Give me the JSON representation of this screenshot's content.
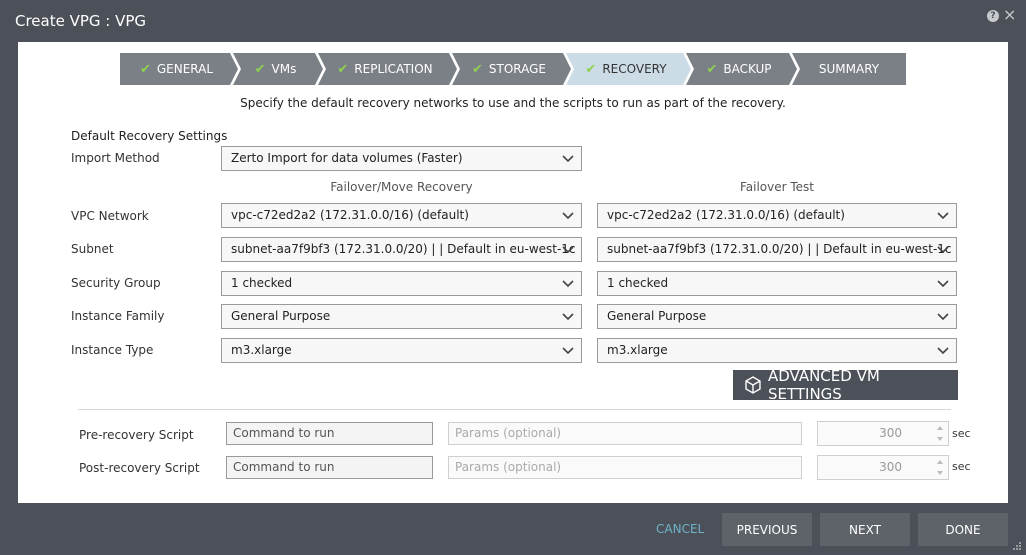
{
  "window": {
    "title": "Create VPG : VPG",
    "help_glyph": "?",
    "close_glyph": "×"
  },
  "wizard": {
    "steps": [
      {
        "label": "GENERAL",
        "done": true
      },
      {
        "label": "VMs",
        "done": true
      },
      {
        "label": "REPLICATION",
        "done": true
      },
      {
        "label": "STORAGE",
        "done": true
      },
      {
        "label": "RECOVERY",
        "done": true,
        "active": true
      },
      {
        "label": "BACKUP",
        "done": true
      },
      {
        "label": "SUMMARY",
        "done": false
      }
    ],
    "check_glyph": "✔",
    "colors": {
      "step": "#7b7f86",
      "active": "#ccdce6",
      "active_text": "#333333",
      "check": "#8fd14f"
    }
  },
  "subtitle": "Specify the default recovery networks to use and the scripts to run as part of the recovery.",
  "recovery": {
    "section_title": "Default Recovery Settings",
    "import_method": {
      "label": "Import Method",
      "value": "Zerto Import for data volumes (Faster)"
    },
    "columns": {
      "failover": "Failover/Move Recovery",
      "test": "Failover Test"
    },
    "rows": [
      {
        "label": "VPC Network",
        "failover": "vpc-c72ed2a2 (172.31.0.0/16) (default)",
        "test": "vpc-c72ed2a2 (172.31.0.0/16) (default)"
      },
      {
        "label": "Subnet",
        "failover": "subnet-aa7f9bf3 (172.31.0.0/20) | | Default in eu-west-1c",
        "test": "subnet-aa7f9bf3 (172.31.0.0/20) | | Default in eu-west-1c"
      },
      {
        "label": "Security Group",
        "failover": "1 checked",
        "test": "1 checked"
      },
      {
        "label": "Instance Family",
        "failover": "General Purpose",
        "test": "General Purpose"
      },
      {
        "label": "Instance Type",
        "failover": "m3.xlarge",
        "test": "m3.xlarge"
      }
    ],
    "advanced_button": "ADVANCED VM SETTINGS"
  },
  "scripts": [
    {
      "label": "Pre-recovery Script",
      "command_placeholder": "Command to run",
      "params_placeholder": "Params (optional)",
      "timeout": "300",
      "unit": "sec"
    },
    {
      "label": "Post-recovery Script",
      "command_placeholder": "Command to run",
      "params_placeholder": "Params (optional)",
      "timeout": "300",
      "unit": "sec"
    }
  ],
  "footer": {
    "cancel": "CANCEL",
    "previous": "PREVIOUS",
    "next": "NEXT",
    "done": "DONE"
  },
  "icons": {
    "dropdown": "chevron-down-icon",
    "advanced": "cube-icon",
    "help": "help-icon",
    "close": "close-icon"
  }
}
